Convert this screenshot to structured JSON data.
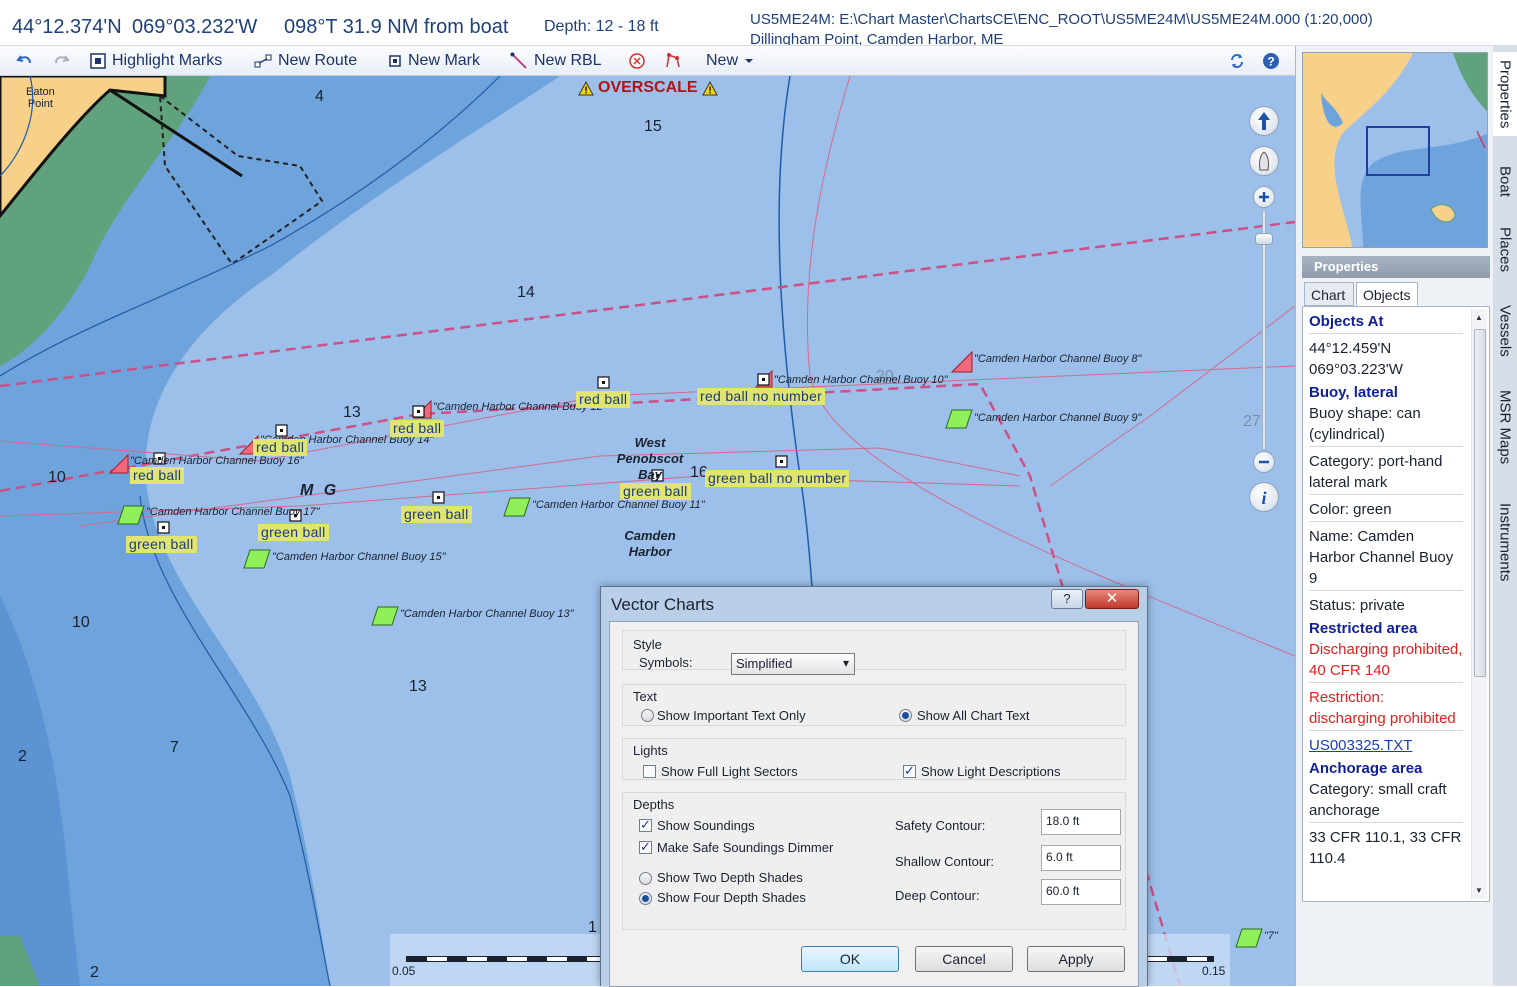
{
  "infobar": {
    "lat": "44°12.374'N",
    "lon": "069°03.232'W",
    "bearing": "098°T 31.9 NM from boat",
    "depth": "Depth: 12 - 18 ft",
    "chart_path": "US5ME24M: E:\\Chart Master\\ChartsCE\\ENC_ROOT\\US5ME24M\\US5ME24M.000 (1:20,000)",
    "chart_name": "Dillingham Point, Camden Harbor, ME"
  },
  "toolbar": {
    "highlight_marks": "Highlight Marks",
    "new_route": "New Route",
    "new_mark": "New Mark",
    "new_rbl": "New RBL",
    "new": "New"
  },
  "map": {
    "overscale": "OVERSCALE",
    "eaton_point": [
      "Eaton",
      "Point"
    ],
    "mg": "M G",
    "west_penobscot_bay": [
      "West",
      "Penobscot",
      "Bay"
    ],
    "camden_harbor": [
      "Camden",
      "Harbor"
    ],
    "soundings": [
      "4",
      "15",
      "14",
      "13",
      "10",
      "16",
      "20",
      "27",
      "10",
      "13",
      "2",
      "7",
      "2",
      "1"
    ],
    "buoy_labels": [
      "\"Camden Harbor Channel Buoy 8\"",
      "\"Camden Harbor Channel Buoy 9\"",
      "\"Camden Harbor Channel Buoy 10\"",
      "\"Camden Harbor Channel Buoy 12\"",
      "\"Camden Harbor Channel Buoy 14\"",
      "\"Camden Harbor Channel Buoy 16\"",
      "\"Camden Harbor Channel Buoy 17\"",
      "\"Camden Harbor Channel Buoy 11\"",
      "\"Camden Harbor Channel Buoy 15\"",
      "\"Camden Harbor Channel Buoy 13\"",
      "\"7\""
    ],
    "ball_labels": {
      "red_ball": "red ball",
      "green_ball": "green ball",
      "red_ball_no_number": "red ball no number",
      "green_ball_no_number": "green ball no number"
    },
    "scale_left": "0.05",
    "scale_right": "0.15"
  },
  "panel": {
    "header": "Properties",
    "tabs": [
      "Chart",
      "Objects"
    ],
    "vertical_tabs": [
      "Properties",
      "Boat",
      "Places",
      "Vessels",
      "MSR Maps",
      "Instruments"
    ],
    "objects": {
      "heading": "Objects At",
      "lat": "44°12.459'N",
      "lon": "069°03.223'W",
      "buoy_title": "Buoy, lateral",
      "buoy_shape": "Buoy shape: can (cylindrical)",
      "category": "Category: port-hand lateral mark",
      "color": "Color: green",
      "name": "Name: Camden Harbor Channel Buoy 9",
      "status": "Status: private",
      "restricted_title": "Restricted area",
      "restricted_desc": "Discharging prohibited, 40 CFR 140",
      "restriction": "Restriction: discharging prohibited",
      "link": "US003325.TXT",
      "anchorage_title": "Anchorage area",
      "anchorage_cat": "Category: small craft anchorage",
      "cfr": "33 CFR 110.1, 33 CFR 110.4"
    }
  },
  "dialog": {
    "title": "Vector Charts",
    "help": "?",
    "style_group": "Style",
    "symbols_label": "Symbols:",
    "symbols_value": "Simplified",
    "text_group": "Text",
    "important_text": "Show Important Text Only",
    "all_text": "Show All Chart Text",
    "lights_group": "Lights",
    "full_sectors": "Show Full Light Sectors",
    "light_desc": "Show Light Descriptions",
    "depths_group": "Depths",
    "show_soundings": "Show Soundings",
    "safe_dimmer": "Make Safe Soundings Dimmer",
    "two_shades": "Show Two Depth Shades",
    "four_shades": "Show Four Depth Shades",
    "safety_contour_label": "Safety Contour:",
    "safety_contour": "18.0 ft",
    "shallow_contour_label": "Shallow Contour:",
    "shallow_contour": "6.0 ft",
    "deep_contour_label": "Deep Contour:",
    "deep_contour": "60.0 ft",
    "ok": "OK",
    "cancel": "Cancel",
    "apply": "Apply"
  },
  "colors": {
    "land": "#f7d08a",
    "shallow_green": "#5fa27c",
    "water_deep_blue": "#6ea3dc",
    "water_light_blue": "#9cc0ea",
    "route_magenta": "#cc4f86"
  }
}
